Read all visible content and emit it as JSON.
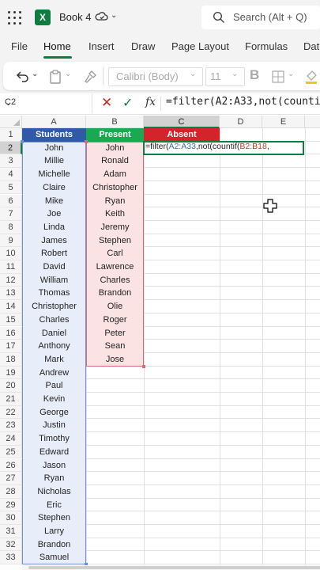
{
  "app": {
    "title": "Book 4",
    "search_placeholder": "Search (Alt + Q)"
  },
  "menu": {
    "items": [
      "File",
      "Home",
      "Insert",
      "Draw",
      "Page Layout",
      "Formulas",
      "Dat"
    ],
    "active": "Home"
  },
  "ribbon": {
    "font_name": "Calibri (Body)",
    "font_size": "11",
    "bold_label": "B"
  },
  "formula_bar": {
    "name_box": "C2",
    "fx_label": "fx",
    "formula": "=filter(A2:A33,not(countif("
  },
  "columns": [
    "A",
    "B",
    "C",
    "D",
    "E"
  ],
  "rows": [
    "1",
    "2",
    "3",
    "4",
    "5",
    "6",
    "7",
    "8",
    "9",
    "10",
    "11",
    "12",
    "13",
    "14",
    "15",
    "16",
    "17",
    "18",
    "19",
    "20",
    "21",
    "22",
    "23",
    "24",
    "25",
    "26",
    "27",
    "28",
    "29",
    "30",
    "31",
    "32",
    "33"
  ],
  "headers": {
    "students": "Students",
    "present": "Present",
    "absent": "Absent"
  },
  "students": [
    "John",
    "Millie",
    "Michelle",
    "Claire",
    "Mike",
    "Joe",
    "Linda",
    "James",
    "Robert",
    "David",
    "William",
    "Thomas",
    "Christopher",
    "Charles",
    "Daniel",
    "Anthony",
    "Mark",
    "Andrew",
    "Paul",
    "Kevin",
    "George",
    "Justin",
    "Timothy",
    "Edward",
    "Jason",
    "Ryan",
    "Nicholas",
    "Eric",
    "Stephen",
    "Larry",
    "Brandon",
    "Samuel"
  ],
  "present": [
    "John",
    "Ronald",
    "Adam",
    "Christopher",
    "Ryan",
    "Keith",
    "Jeremy",
    "Stephen",
    "Carl",
    "Lawrence",
    "Charles",
    "Brandon",
    "Olie",
    "Roger",
    "Peter",
    "Sean",
    "Jose"
  ],
  "active_cell": {
    "p1": "=filter(",
    "p2": "A2:A33",
    "p3": ",not(countif(",
    "p4": "B2:B18",
    "p5": ","
  },
  "colors": {
    "students_header": "#2e5aa8",
    "present_header": "#1aa851",
    "absent_header": "#d4232b",
    "accent": "#107c41"
  }
}
